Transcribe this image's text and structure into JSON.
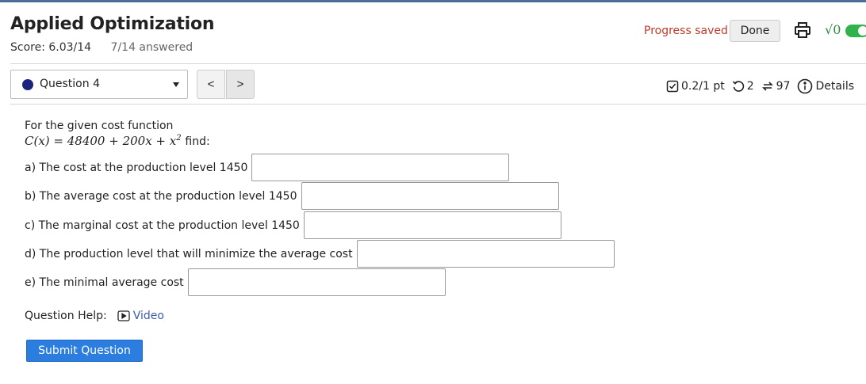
{
  "header": {
    "title": "Applied Optimization",
    "score": "Score: 6.03/14",
    "answered": "7/14 answered",
    "progress_saved": "Progress saved",
    "done_label": "Done",
    "math_icon_text": "√0"
  },
  "nav": {
    "question_select": "Question 4",
    "prev": "<",
    "next": ">"
  },
  "stats": {
    "points": "0.2/1 pt",
    "retries": "2",
    "attempts": "97",
    "details": "Details"
  },
  "question": {
    "intro": "For the given cost function",
    "formula": {
      "lhs": "C(x) = 48400 + 200x + x",
      "exp": "2",
      "suffix": "find:"
    },
    "parts": [
      {
        "label": "a) The cost at the production level 1450",
        "value": ""
      },
      {
        "label": "b) The average cost at the production level 1450",
        "value": ""
      },
      {
        "label": "c) The marginal cost at the production level 1450",
        "value": ""
      },
      {
        "label": "d) The production level that will minimize the average cost",
        "value": ""
      },
      {
        "label": "e) The minimal average cost",
        "value": ""
      }
    ]
  },
  "help": {
    "label": "Question Help:",
    "video": "Video"
  },
  "submit_label": "Submit Question",
  "colors": {
    "accent": "#2b7de0",
    "progress_saved": "#c0392b",
    "toggle": "#2fb34a",
    "link": "#3b5ba9"
  }
}
